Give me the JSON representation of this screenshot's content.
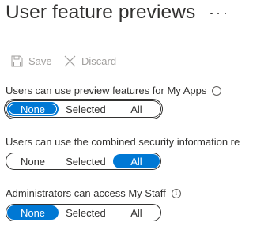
{
  "header": {
    "title": "User feature previews",
    "more_icon": "more-ellipsis-icon"
  },
  "commands": {
    "save_label": "Save",
    "save_icon": "floppy-disk-icon",
    "discard_label": "Discard",
    "discard_icon": "x-icon"
  },
  "settings": [
    {
      "label": "Users can use preview features for My Apps",
      "has_info": true,
      "options": [
        "None",
        "Selected",
        "All"
      ],
      "selected": "None"
    },
    {
      "label": "Users can use the combined security information re",
      "has_info": false,
      "options": [
        "None",
        "Selected",
        "All"
      ],
      "selected": "All"
    },
    {
      "label": "Administrators can access My Staff",
      "has_info": true,
      "options": [
        "None",
        "Selected",
        "All"
      ],
      "selected": "None"
    }
  ],
  "colors": {
    "accent": "#0078d4",
    "text": "#323130",
    "disabled": "#a19f9d"
  }
}
